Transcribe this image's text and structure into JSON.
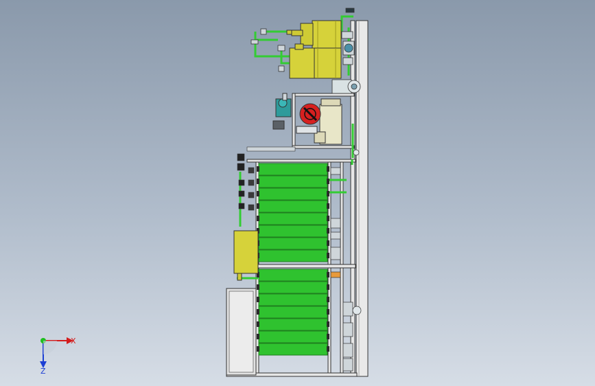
{
  "viewport": {
    "background_top": "#8a99ab",
    "background_bottom": "#d6dde6"
  },
  "model": {
    "membrane_vessels_upper": 8,
    "membrane_vessels_lower": 7,
    "colors": {
      "membrane": "#2fc22f",
      "tank": "#d6d23a",
      "frame": "#e6e6e6",
      "pipe_green": "#33cc33",
      "pump_red": "#d62020",
      "cartridge_filter": "#e8e6c8",
      "outline": "#333333"
    },
    "parts": [
      "upper-tanks",
      "cartridge-filter",
      "high-pressure-pump",
      "membrane-rack",
      "junction-box",
      "control-cabinet",
      "main-column"
    ]
  },
  "triad": {
    "x_label": "X",
    "z_label": "Z",
    "x_color": "#d41c1c",
    "y_color": "#1fbf1f",
    "z_color": "#1c3fd4",
    "icon": "coordinate-triad-icon"
  }
}
